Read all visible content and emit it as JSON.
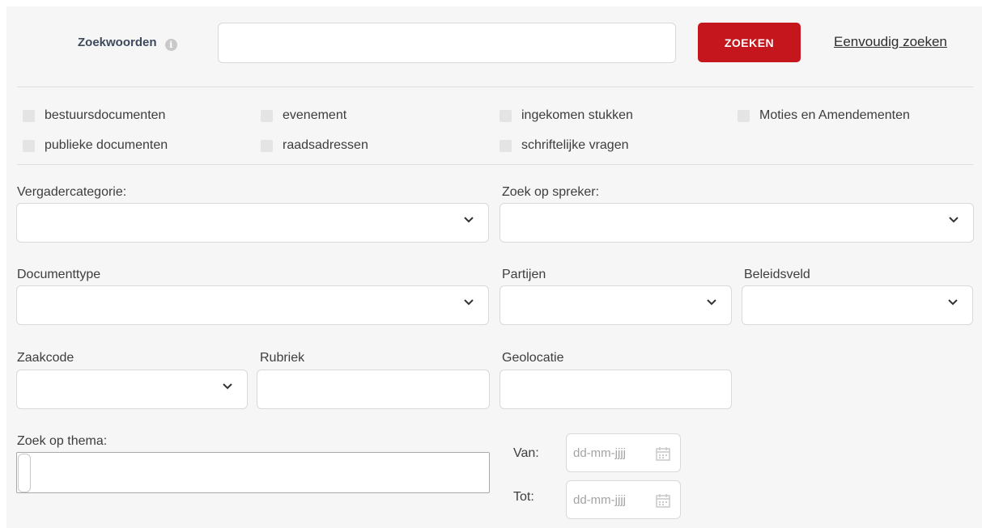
{
  "search": {
    "keywords_label": "Zoekwoorden",
    "info_icon": "info-icon",
    "keywords_value": "",
    "search_button": "ZOEKEN",
    "simple_search_link": "Eenvoudig zoeken"
  },
  "checkboxes": [
    {
      "label": "bestuursdocumenten",
      "checked": false
    },
    {
      "label": "evenement",
      "checked": false
    },
    {
      "label": "ingekomen stukken",
      "checked": false
    },
    {
      "label": "Moties en Amendementen",
      "checked": false
    },
    {
      "label": "publieke documenten",
      "checked": false
    },
    {
      "label": "raadsadressen",
      "checked": false
    },
    {
      "label": "schriftelijke vragen",
      "checked": false
    }
  ],
  "filters": {
    "vergadercategorie": {
      "label": "Vergadercategorie:",
      "value": ""
    },
    "spreker": {
      "label": "Zoek op spreker:",
      "value": ""
    },
    "documenttype": {
      "label": "Documenttype",
      "value": ""
    },
    "partijen": {
      "label": "Partijen",
      "value": ""
    },
    "beleidsveld": {
      "label": "Beleidsveld",
      "value": ""
    },
    "zaakcode": {
      "label": "Zaakcode",
      "value": ""
    },
    "rubriek": {
      "label": "Rubriek",
      "value": ""
    },
    "geolocatie": {
      "label": "Geolocatie",
      "value": ""
    },
    "thema": {
      "label": "Zoek op thema:",
      "value": ""
    }
  },
  "dates": {
    "van_label": "Van:",
    "van_placeholder": "dd-mm-jjjj",
    "tot_label": "Tot:",
    "tot_placeholder": "dd-mm-jjjj"
  },
  "colors": {
    "accent": "#c4161c",
    "panel_bg": "#f6f6f6",
    "field_border": "#d9d9d9"
  }
}
